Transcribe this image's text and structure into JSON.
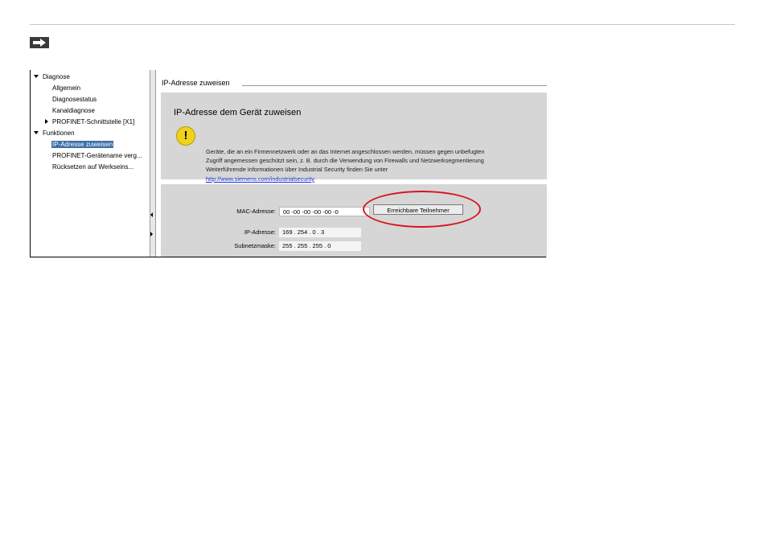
{
  "nav": {
    "diagnose": "Diagnose",
    "allgemein": "Allgemein",
    "diagnosestatus": "Diagnosestatus",
    "kanaldiagnose": "Kanaldiagnose",
    "profinet_schnittstelle": "PROFINET-Schnittstelle [X1]",
    "funktionen": "Funktionen",
    "ip_zuweisen": "IP-Adresse zuweisen",
    "geraetename": "PROFINET-Gerätename verg...",
    "ruecksetzen": "Rücksetzen auf Werkseins..."
  },
  "panel": {
    "section_title": "IP-Adresse zuweisen",
    "info_title": "IP-Adresse dem Gerät zuweisen",
    "info_line1": "Geräte, die an ein Firmennetzwerk oder an das Internet angeschlossen werden, müssen gegen unbefugten",
    "info_line2": "Zugriff angemessen geschützt sein, z. B. durch die Verwendung von Firewalls und Netzwerksegmentierung",
    "info_line3": "Weiterführende Informationen über Industrial Security finden Sie unter",
    "info_link": "http://www.siemens.com/industrialsecurity"
  },
  "form": {
    "mac_label": "MAC-Adresse:",
    "mac_value": "00 -00 -00 -00 -00 -0",
    "ip_label": "IP-Adresse:",
    "ip_value": "169 . 254 . 0 . 3",
    "mask_label": "Subnetzmaske:",
    "mask_value": "255 . 255 . 255 . 0",
    "button_label": "Erreichbare Teilnehmer"
  },
  "colors": {
    "highlight_ellipse": "#d8141e",
    "selection": "#3a6ea5",
    "warning": "#f0d21a"
  }
}
